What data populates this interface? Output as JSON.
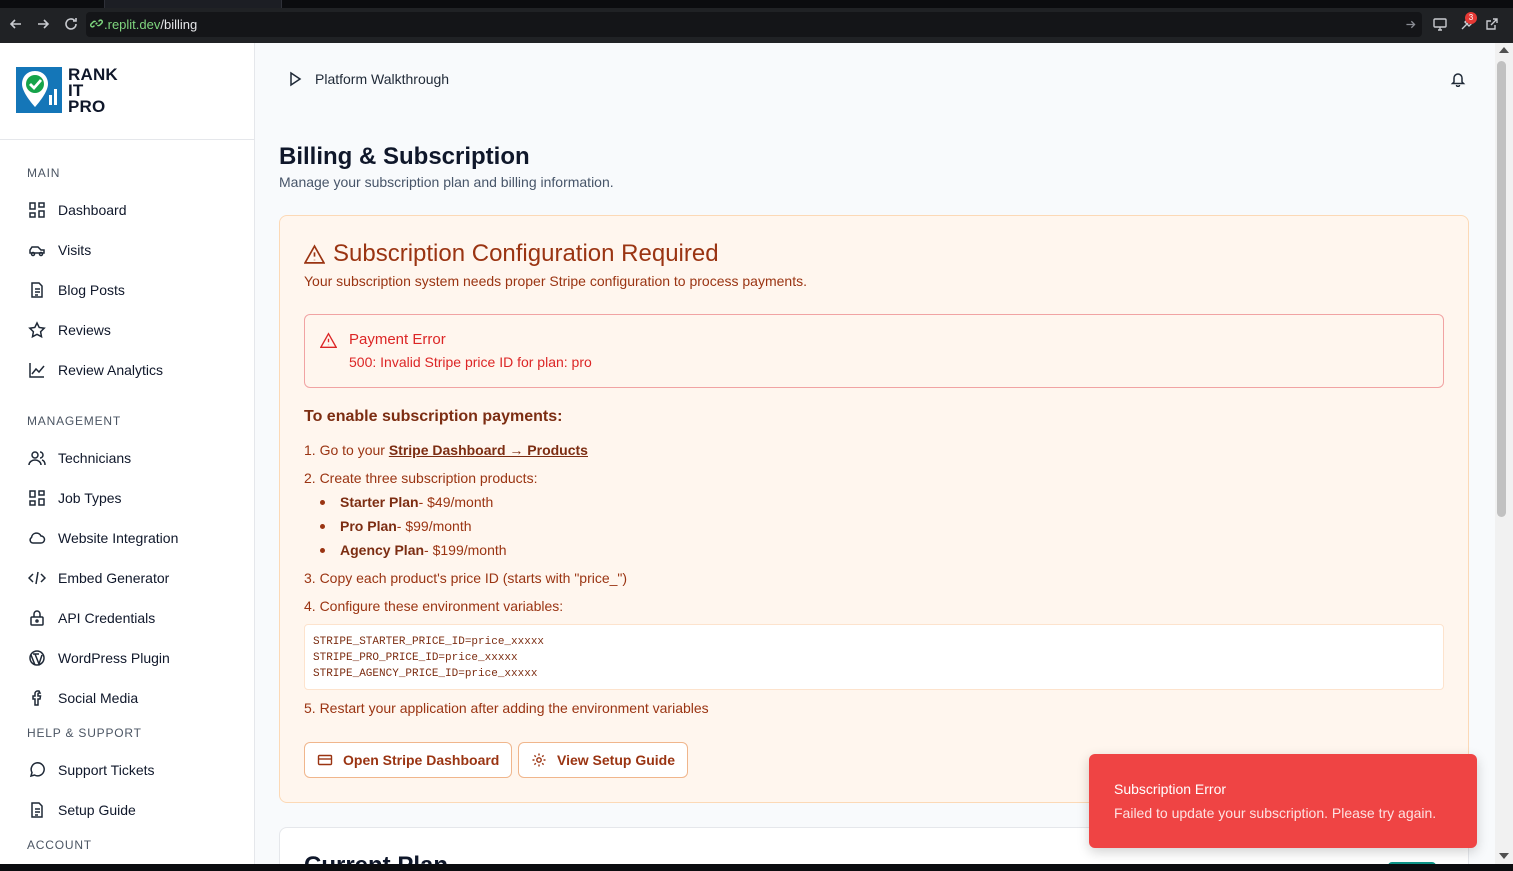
{
  "browser": {
    "url_host": ".replit.dev",
    "url_path": "/billing",
    "notification_count": "3"
  },
  "brand": {
    "line1": "RANK",
    "line2": "IT",
    "line3": "PRO"
  },
  "sidebar": {
    "sections": [
      {
        "label": "MAIN"
      },
      {
        "label": "MANAGEMENT"
      },
      {
        "label": "HELP & SUPPORT"
      },
      {
        "label": "ACCOUNT"
      }
    ],
    "items": [
      {
        "label": "Dashboard",
        "icon": "grid-icon"
      },
      {
        "label": "Visits",
        "icon": "car-icon"
      },
      {
        "label": "Blog Posts",
        "icon": "document-icon"
      },
      {
        "label": "Reviews",
        "icon": "star-icon"
      },
      {
        "label": "Review Analytics",
        "icon": "line-chart-icon"
      },
      {
        "label": "Technicians",
        "icon": "users-icon"
      },
      {
        "label": "Job Types",
        "icon": "grid-icon"
      },
      {
        "label": "Website Integration",
        "icon": "cloud-icon"
      },
      {
        "label": "Embed Generator",
        "icon": "code-icon"
      },
      {
        "label": "API Credentials",
        "icon": "lock-icon"
      },
      {
        "label": "WordPress Plugin",
        "icon": "wordpress-icon"
      },
      {
        "label": "Social Media",
        "icon": "facebook-icon"
      },
      {
        "label": "Support Tickets",
        "icon": "chat-icon"
      },
      {
        "label": "Setup Guide",
        "icon": "document-icon"
      }
    ]
  },
  "header": {
    "walkthrough_label": "Platform Walkthrough"
  },
  "page": {
    "title": "Billing & Subscription",
    "subtitle": "Manage your subscription plan and billing information."
  },
  "config": {
    "title": "Subscription Configuration Required",
    "subtitle": "Your subscription system needs proper Stripe configuration to process payments.",
    "error_title": "Payment Error",
    "error_message": "500: Invalid Stripe price ID for plan: pro",
    "steps_title": "To enable subscription payments:",
    "step1_prefix": "1. Go to your ",
    "step1_link": "Stripe Dashboard → Products",
    "step2": "2. Create three subscription products:",
    "plans": [
      {
        "name": "Starter Plan",
        "price": " - $49/month"
      },
      {
        "name": "Pro Plan",
        "price": " - $99/month"
      },
      {
        "name": "Agency Plan",
        "price": " - $199/month"
      }
    ],
    "step3": "3. Copy each product's price ID (starts with \"price_\")",
    "step4": "4. Configure these environment variables:",
    "env_vars": [
      "STRIPE_STARTER_PRICE_ID=price_xxxxx",
      "STRIPE_PRO_PRICE_ID=price_xxxxx",
      "STRIPE_AGENCY_PRICE_ID=price_xxxxx"
    ],
    "step5": "5. Restart your application after adding the environment variables",
    "open_stripe_label": "Open Stripe Dashboard",
    "setup_guide_label": "View Setup Guide"
  },
  "current_plan": {
    "title": "Current Plan"
  },
  "toast": {
    "title": "Subscription Error",
    "message": "Failed to update your subscription. Please try again."
  }
}
